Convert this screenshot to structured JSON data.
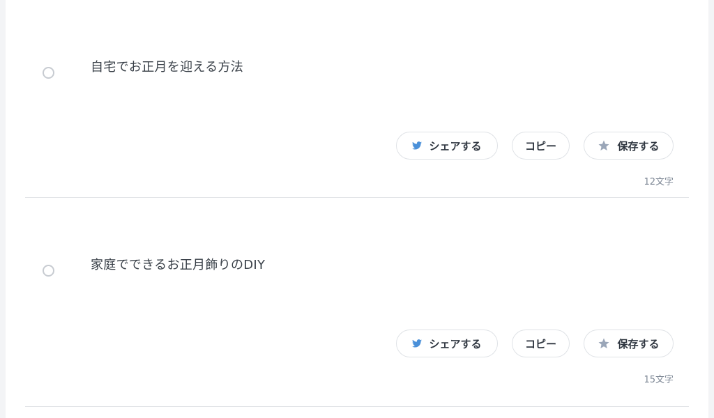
{
  "items": [
    {
      "text": "自宅でお正月を迎える方法",
      "share_label": "シェアする",
      "copy_label": "コピー",
      "save_label": "保存する",
      "char_count": "12文字"
    },
    {
      "text": "家庭でできるお正月飾りのDIY",
      "share_label": "シェアする",
      "copy_label": "コピー",
      "save_label": "保存する",
      "char_count": "15文字"
    }
  ],
  "icons": {
    "share": "twitter-bird-icon",
    "save": "star-icon"
  },
  "colors": {
    "twitter_blue": "#4a90d9",
    "star_gray": "#9aa6b8",
    "divider": "#e3e5e8",
    "muted_text": "#7c8694"
  }
}
